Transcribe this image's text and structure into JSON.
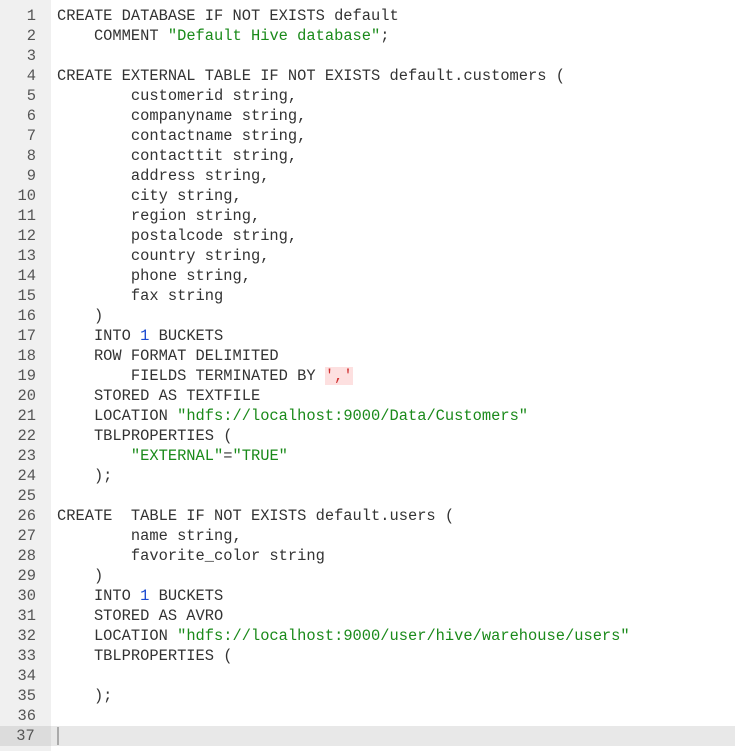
{
  "editor": {
    "lines": [
      {
        "n": "1",
        "tokens": [
          {
            "t": "CREATE DATABASE IF NOT EXISTS default",
            "c": ""
          }
        ]
      },
      {
        "n": "2",
        "tokens": [
          {
            "t": "    COMMENT ",
            "c": ""
          },
          {
            "t": "\"Default Hive database\"",
            "c": "str"
          },
          {
            "t": ";",
            "c": ""
          }
        ]
      },
      {
        "n": "3",
        "tokens": []
      },
      {
        "n": "4",
        "tokens": [
          {
            "t": "CREATE EXTERNAL TABLE IF NOT EXISTS default.customers (",
            "c": ""
          }
        ]
      },
      {
        "n": "5",
        "tokens": [
          {
            "t": "        customerid string,",
            "c": ""
          }
        ]
      },
      {
        "n": "6",
        "tokens": [
          {
            "t": "        companyname string,",
            "c": ""
          }
        ]
      },
      {
        "n": "7",
        "tokens": [
          {
            "t": "        contactname string,",
            "c": ""
          }
        ]
      },
      {
        "n": "8",
        "tokens": [
          {
            "t": "        contacttit string,",
            "c": ""
          }
        ]
      },
      {
        "n": "9",
        "tokens": [
          {
            "t": "        address string,",
            "c": ""
          }
        ]
      },
      {
        "n": "10",
        "tokens": [
          {
            "t": "        city string,",
            "c": ""
          }
        ]
      },
      {
        "n": "11",
        "tokens": [
          {
            "t": "        region string,",
            "c": ""
          }
        ]
      },
      {
        "n": "12",
        "tokens": [
          {
            "t": "        postalcode string,",
            "c": ""
          }
        ]
      },
      {
        "n": "13",
        "tokens": [
          {
            "t": "        country string,",
            "c": ""
          }
        ]
      },
      {
        "n": "14",
        "tokens": [
          {
            "t": "        phone string,",
            "c": ""
          }
        ]
      },
      {
        "n": "15",
        "tokens": [
          {
            "t": "        fax string",
            "c": ""
          }
        ]
      },
      {
        "n": "16",
        "tokens": [
          {
            "t": "    )",
            "c": ""
          }
        ]
      },
      {
        "n": "17",
        "tokens": [
          {
            "t": "    INTO ",
            "c": ""
          },
          {
            "t": "1",
            "c": "num"
          },
          {
            "t": " BUCKETS",
            "c": ""
          }
        ]
      },
      {
        "n": "18",
        "tokens": [
          {
            "t": "    ROW FORMAT DELIMITED",
            "c": ""
          }
        ]
      },
      {
        "n": "19",
        "tokens": [
          {
            "t": "        FIELDS TERMINATED BY ",
            "c": ""
          },
          {
            "t": "','",
            "c": "err"
          }
        ]
      },
      {
        "n": "20",
        "tokens": [
          {
            "t": "    STORED AS TEXTFILE",
            "c": ""
          }
        ]
      },
      {
        "n": "21",
        "tokens": [
          {
            "t": "    LOCATION ",
            "c": ""
          },
          {
            "t": "\"hdfs://localhost:9000/Data/Customers\"",
            "c": "str"
          }
        ]
      },
      {
        "n": "22",
        "tokens": [
          {
            "t": "    TBLPROPERTIES (",
            "c": ""
          }
        ]
      },
      {
        "n": "23",
        "tokens": [
          {
            "t": "        ",
            "c": ""
          },
          {
            "t": "\"EXTERNAL\"",
            "c": "str"
          },
          {
            "t": "=",
            "c": ""
          },
          {
            "t": "\"TRUE\"",
            "c": "str"
          }
        ]
      },
      {
        "n": "24",
        "tokens": [
          {
            "t": "    );",
            "c": ""
          }
        ]
      },
      {
        "n": "25",
        "tokens": []
      },
      {
        "n": "26",
        "tokens": [
          {
            "t": "CREATE  TABLE IF NOT EXISTS default.users (",
            "c": ""
          }
        ]
      },
      {
        "n": "27",
        "tokens": [
          {
            "t": "        name string,",
            "c": ""
          }
        ]
      },
      {
        "n": "28",
        "tokens": [
          {
            "t": "        favorite_color string",
            "c": ""
          }
        ]
      },
      {
        "n": "29",
        "tokens": [
          {
            "t": "    )",
            "c": ""
          }
        ]
      },
      {
        "n": "30",
        "tokens": [
          {
            "t": "    INTO ",
            "c": ""
          },
          {
            "t": "1",
            "c": "num"
          },
          {
            "t": " BUCKETS",
            "c": ""
          }
        ]
      },
      {
        "n": "31",
        "tokens": [
          {
            "t": "    STORED AS AVRO",
            "c": ""
          }
        ]
      },
      {
        "n": "32",
        "tokens": [
          {
            "t": "    LOCATION ",
            "c": ""
          },
          {
            "t": "\"hdfs://localhost:9000/user/hive/warehouse/users\"",
            "c": "str"
          }
        ]
      },
      {
        "n": "33",
        "tokens": [
          {
            "t": "    TBLPROPERTIES (",
            "c": ""
          }
        ]
      },
      {
        "n": "34",
        "tokens": []
      },
      {
        "n": "35",
        "tokens": [
          {
            "t": "    );",
            "c": ""
          }
        ]
      },
      {
        "n": "36",
        "tokens": []
      },
      {
        "n": "37",
        "tokens": [],
        "active": true
      }
    ],
    "colors": {
      "string": "#1a8a1a",
      "number": "#1a4ad0",
      "error": "#d03030"
    }
  }
}
